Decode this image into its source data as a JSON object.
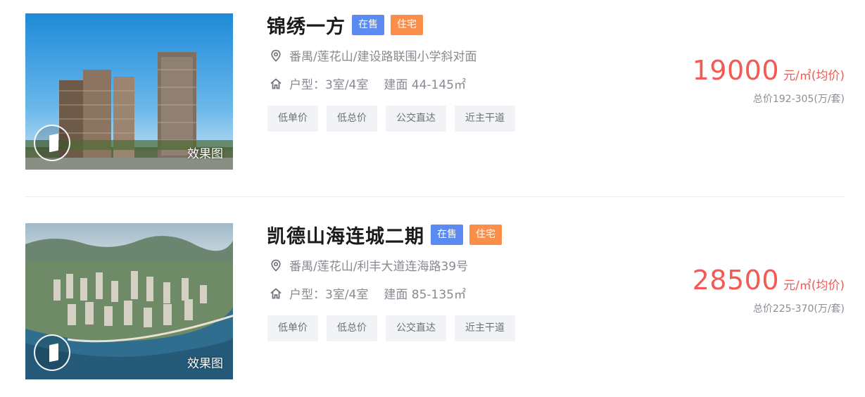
{
  "listings": [
    {
      "name": "锦绣一方",
      "status_tag": "在售",
      "type_tag": "住宅",
      "location": "番禺/莲花山/建设路联围小学斜对面",
      "layout_label": "户型：",
      "layout": "3室/4室",
      "area": "建面 44-145㎡",
      "features": [
        "低单价",
        "低总价",
        "公交直达",
        "近主干道"
      ],
      "price": "19000",
      "price_unit": "元/㎡(均价)",
      "total_price": "总价192-305(万/套)",
      "image_label": "效果图"
    },
    {
      "name": "凯德山海连城二期",
      "status_tag": "在售",
      "type_tag": "住宅",
      "location": "番禺/莲花山/利丰大道连海路39号",
      "layout_label": "户型：",
      "layout": "3室/4室",
      "area": "建面 85-135㎡",
      "features": [
        "低单价",
        "低总价",
        "公交直达",
        "近主干道"
      ],
      "price": "28500",
      "price_unit": "元/㎡(均价)",
      "total_price": "总价225-370(万/套)",
      "image_label": "效果图"
    }
  ],
  "colors": {
    "status_tag": "#5b8bf0",
    "type_tag": "#fb8f4a",
    "price": "#f25a53",
    "feature_bg": "#f1f3f6"
  },
  "icons": {
    "location": "location-pin-icon",
    "layout": "house-icon",
    "video": "video-play-icon"
  }
}
